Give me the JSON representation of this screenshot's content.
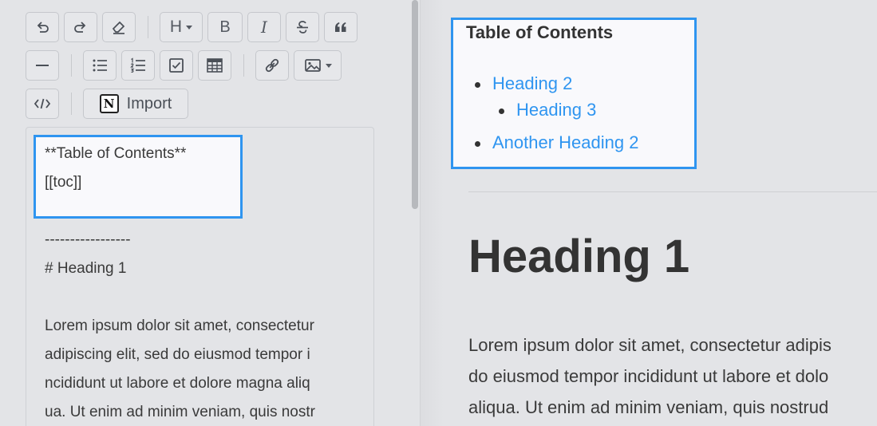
{
  "toolbar": {
    "heading_label": "H",
    "bold_label": "B",
    "italic_label": "I",
    "import_label": "Import",
    "notion_logo": "N"
  },
  "editor": {
    "lines": [
      "**Table of Contents**",
      "[[toc]]",
      "-----------------",
      "# Heading 1",
      "Lorem ipsum dolor sit amet, consectetur",
      "adipiscing elit, sed do eiusmod tempor i",
      "ncididunt ut labore et dolore magna aliq",
      "ua. Ut enim ad minim veniam, quis nostr"
    ]
  },
  "preview": {
    "toc_title": "Table of Contents",
    "toc_items": [
      "Heading 2",
      "Heading 3",
      "Another Heading 2"
    ],
    "heading": "Heading 1",
    "paragraph_lines": [
      "Lorem ipsum dolor sit amet, consectetur adipis",
      "do eiusmod tempor incididunt ut labore et dolo",
      "aliqua. Ut enim ad minim veniam, quis nostrud"
    ]
  },
  "icons": [
    "undo-icon",
    "redo-icon",
    "eraser-icon",
    "heading-icon",
    "bold-icon",
    "italic-icon",
    "strikethrough-icon",
    "quote-icon",
    "horizontal-rule-icon",
    "bullet-list-icon",
    "ordered-list-icon",
    "checklist-icon",
    "table-icon",
    "link-icon",
    "image-icon",
    "code-icon",
    "notion-icon"
  ],
  "colors": {
    "accent": "#2f95f0",
    "background": "#e3e4e7",
    "text": "#333333"
  }
}
